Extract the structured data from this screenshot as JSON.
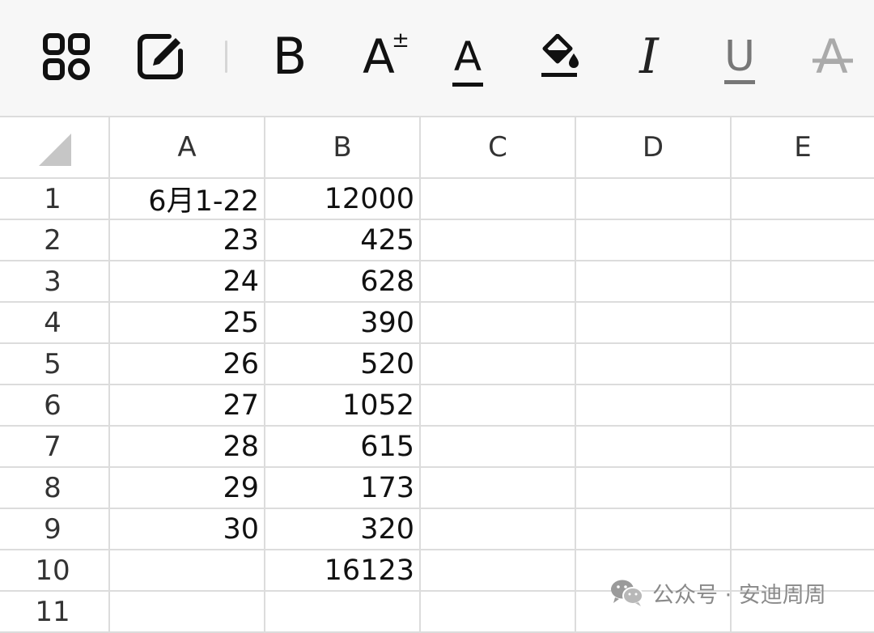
{
  "toolbar": {
    "items": [
      {
        "name": "apps-icon"
      },
      {
        "name": "edit-icon"
      },
      {
        "name": "bold-icon",
        "glyph": "B"
      },
      {
        "name": "font-size-icon",
        "glyph": "A",
        "sup": "±"
      },
      {
        "name": "font-color-icon",
        "glyph": "A"
      },
      {
        "name": "fill-color-icon"
      },
      {
        "name": "italic-icon",
        "glyph": "I"
      },
      {
        "name": "underline-icon",
        "glyph": "U"
      },
      {
        "name": "strikethrough-icon",
        "glyph": "A"
      }
    ]
  },
  "sheet": {
    "columns": [
      "A",
      "B",
      "C",
      "D",
      "E"
    ],
    "rows": [
      {
        "num": "1",
        "A": "6月1-22",
        "B": "12000"
      },
      {
        "num": "2",
        "A": "23",
        "B": "425"
      },
      {
        "num": "3",
        "A": "24",
        "B": "628"
      },
      {
        "num": "4",
        "A": "25",
        "B": "390"
      },
      {
        "num": "5",
        "A": "26",
        "B": "520"
      },
      {
        "num": "6",
        "A": "27",
        "B": "1052"
      },
      {
        "num": "7",
        "A": "28",
        "B": "615"
      },
      {
        "num": "8",
        "A": "29",
        "B": "173"
      },
      {
        "num": "9",
        "A": "30",
        "B": "320"
      },
      {
        "num": "10",
        "A": "",
        "B": "16123"
      },
      {
        "num": "11",
        "A": "",
        "B": ""
      }
    ]
  },
  "watermark": {
    "text": "公众号 · 安迪周周",
    "icon": "wechat-icon"
  }
}
